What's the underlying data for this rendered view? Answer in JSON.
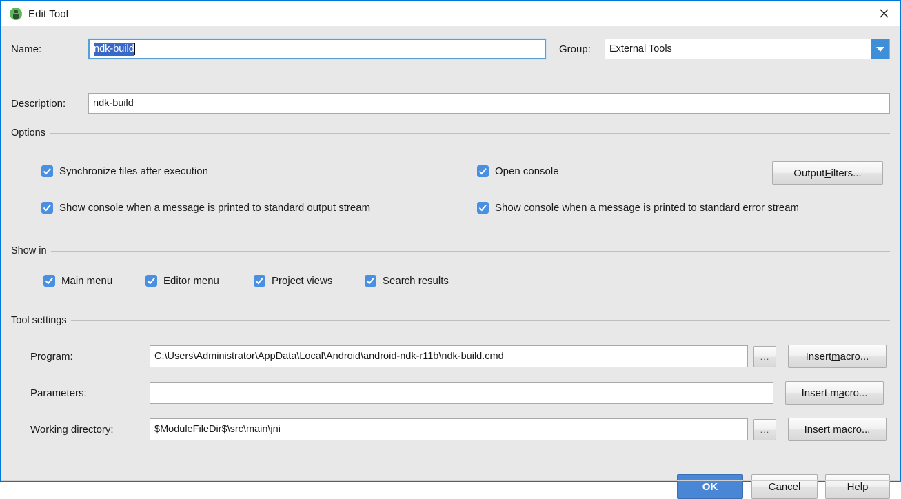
{
  "window": {
    "title": "Edit Tool",
    "app_icon": "android-studio-icon",
    "close_icon": "close-icon",
    "border_color": "#0078d7",
    "body_color": "#e8e8e8"
  },
  "name_field": {
    "label": "Name:",
    "value": "ndk-build",
    "selected": true,
    "focused": true,
    "selection_color": "#3a68c8"
  },
  "group_field": {
    "label": "Group:",
    "value": "External Tools",
    "arrow_icon": "chevron-down-icon",
    "arrow_color": "#3f8fd8"
  },
  "description_field": {
    "label": "Description:",
    "value": "ndk-build"
  },
  "options": {
    "title": "Options",
    "checkbox_color": "#4a90e2",
    "items": [
      {
        "label": "Synchronize files after execution",
        "checked": true
      },
      {
        "label": "Open console",
        "checked": true
      },
      {
        "label": "Show console when a message is printed to standard output stream",
        "checked": true
      },
      {
        "label": "Show console when a message is printed to standard error stream",
        "checked": true
      }
    ],
    "output_filters_button": {
      "prefix": "Output ",
      "mnemonic": "F",
      "suffix": "ilters..."
    }
  },
  "show_in": {
    "title": "Show in",
    "items": [
      {
        "label": "Main menu",
        "checked": true
      },
      {
        "label": "Editor menu",
        "checked": true
      },
      {
        "label": "Project views",
        "checked": true
      },
      {
        "label": "Search results",
        "checked": true
      }
    ]
  },
  "tool_settings": {
    "title": "Tool settings",
    "program": {
      "label": "Program:",
      "value": "C:\\Users\\Administrator\\AppData\\Local\\Android\\android-ndk-r11b\\ndk-build.cmd",
      "browse_label": "...",
      "macro_button": {
        "prefix": "Insert ",
        "mnemonic": "m",
        "suffix": "acro..."
      }
    },
    "parameters": {
      "label": "Parameters:",
      "value": "",
      "macro_button": {
        "prefix": "Insert m",
        "mnemonic": "a",
        "suffix": "cro..."
      }
    },
    "working_directory": {
      "label": "Working directory:",
      "value": "$ModuleFileDir$\\src\\main\\jni",
      "browse_label": "...",
      "macro_button": {
        "prefix": "Insert ma",
        "mnemonic": "c",
        "suffix": "ro..."
      }
    }
  },
  "footer": {
    "ok_label": "OK",
    "cancel_label": "Cancel",
    "help_label": "Help",
    "ok_color": "#4a86d6"
  }
}
